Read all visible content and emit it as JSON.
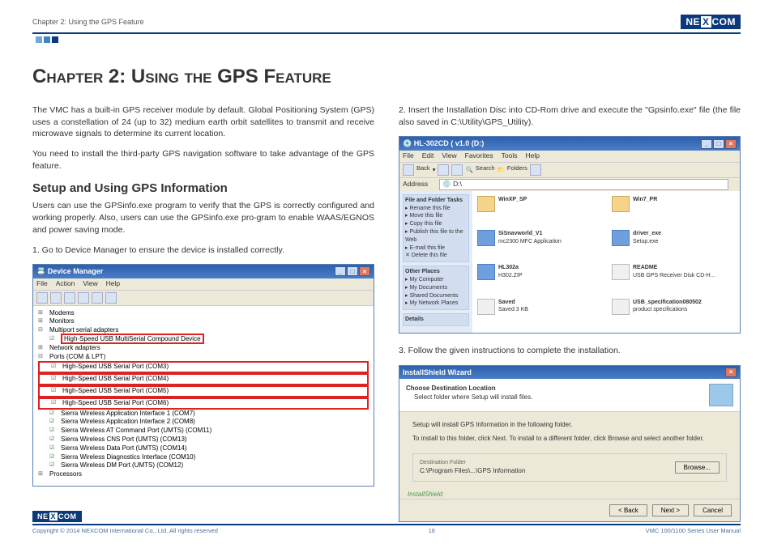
{
  "header": {
    "chapter_label": "Chapter 2: Using the GPS Feature",
    "logo_text": "NE",
    "logo_x": "X",
    "logo_text2": "COM"
  },
  "title": "Chapter 2: Using the GPS Feature",
  "intro1": "The VMC has a built-in GPS receiver module by default. Global Positioning System (GPS) uses a constellation of 24 (up to 32) medium earth orbit satellites to transmit and receive microwave signals to determine its current location.",
  "intro2": "You need to install the third-party GPS navigation software to take advantage of the GPS feature.",
  "section_heading": "Setup and Using GPS Information",
  "section_intro": "Users can use the GPSinfo.exe program to verify that the GPS is correctly configured and working properly. Also, users can use the GPSinfo.exe pro-gram to enable WAAS/EGNOS and power saving mode.",
  "step1": "1. Go to Device Manager to ensure the device is installed correctly.",
  "step2": "2. Insert the Installation Disc into CD-Rom drive and execute the \"Gpsinfo.exe\" file (the file also saved in C:\\Utility\\GPS_Utility).",
  "step3": "3. Follow the given instructions to complete the installation.",
  "devmgr": {
    "title": "Device Manager",
    "menu": {
      "file": "File",
      "action": "Action",
      "view": "View",
      "help": "Help"
    },
    "tree": {
      "n1": "Modems",
      "n2": "Monitors",
      "n3": "Multiport serial adapters",
      "hl1": "High-Speed USB MultiSerial Compound Device",
      "n4": "Network adapters",
      "n5": "Ports (COM & LPT)",
      "p1": "High-Speed USB Serial Port (COM3)",
      "p2": "High-Speed USB Serial Port (COM4)",
      "p3": "High-Speed USB Serial Port (COM5)",
      "p4": "High-Speed USB Serial Port (COM6)",
      "s1": "Sierra Wireless Application Interface 1 (COM7)",
      "s2": "Sierra Wireless Application Interface 2 (COM8)",
      "s3": "Sierra Wireless AT Command Port (UMTS) (COM11)",
      "s4": "Sierra Wireless CNS Port (UMTS) (COM13)",
      "s5": "Sierra Wireless Data Port (UMTS) (COM14)",
      "s6": "Sierra Wireless Diagnostics Interface (COM10)",
      "s7": "Sierra Wireless DM Port (UMTS) (COM12)",
      "n6": "Processors"
    }
  },
  "explorer": {
    "title": "HL-302CD ( v1.0 (D:)",
    "menu": {
      "m1": "File",
      "m2": "Edit",
      "m3": "View",
      "m4": "Favorites",
      "m5": "Tools",
      "m6": "Help"
    },
    "tool": {
      "back": "Back",
      "search": "Search",
      "folders": "Folders"
    },
    "address_label": "Address",
    "address": "D:\\",
    "side": {
      "g1_title": "File and Folder Tasks",
      "g1_1": "Rename this file",
      "g1_2": "Move this file",
      "g1_3": "Copy this file",
      "g1_4": "Publish this file to the Web",
      "g1_5": "E-mail this file",
      "g1_6": "Delete this file",
      "g2_title": "Other Places",
      "g2_1": "My Computer",
      "g2_2": "My Documents",
      "g2_3": "Shared Documents",
      "g2_4": "My Network Places",
      "g3_title": "Details"
    },
    "files": {
      "f1": "WinXP_SP",
      "f2": "Win7_PR",
      "f3": "SiSnavworld_V1",
      "f3s": "mc2300 MFC Application",
      "f4": "driver_exe",
      "f4s": "Setup.exe",
      "f5": "HL302a",
      "f5s": "H302.ZIP",
      "f6": "README",
      "f6s": "USB GPS Receiver Disk CD-H...",
      "f7": "Saved",
      "f7s": "Saved 3 KB",
      "f8": "USB_specification080502",
      "f8s": "product specifications"
    }
  },
  "wizard": {
    "title": "InstallShield Wizard",
    "head1": "Choose Destination Location",
    "head2": "Select folder where Setup will install files.",
    "line1": "Setup will install GPS Information in the following folder.",
    "line2": "To install to this folder, click Next. To install to a different folder, click Browse and select another folder.",
    "dest_label": "Destination Folder",
    "dest_path": "C:\\Program Files\\...\\GPS Information",
    "browse": "Browse...",
    "brand": "InstallShield",
    "back": "< Back",
    "next": "Next >",
    "cancel": "Cancel"
  },
  "footer": {
    "copyright": "Copyright © 2014 NEXCOM International Co., Ltd. All rights reserved",
    "page": "16",
    "manual": "VMC 100/1100 Series User Manual"
  }
}
